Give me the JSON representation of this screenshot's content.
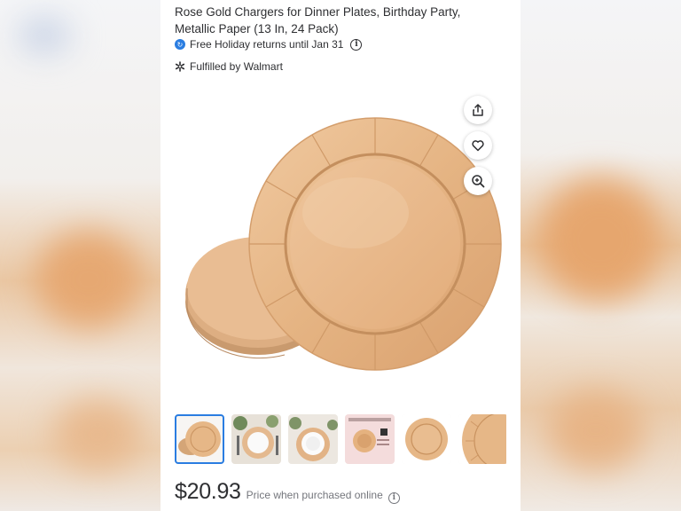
{
  "product": {
    "title": "Rose Gold Chargers for Dinner Plates, Birthday Party, Metallic Paper (13 In, 24 Pack)",
    "returns_text": "Free Holiday returns until Jan 31",
    "fulfilled_text": "Fulfilled by Walmart",
    "price": "$20.93",
    "price_note": "Price when purchased online"
  },
  "icons": {
    "returns": "returns-icon",
    "info": "info-icon",
    "spark": "walmart-spark-icon",
    "share": "share-icon",
    "favorite": "heart-icon",
    "zoom": "zoom-in-icon"
  },
  "gallery": {
    "selected_index": 0,
    "thumbnails": [
      "plate-stack",
      "table-setting",
      "white-plate-setting",
      "package-front",
      "single-plate",
      "plate-close-up"
    ]
  },
  "colors": {
    "accent": "#2a7de1",
    "plate": "#e6b787",
    "text": "#2e2f32",
    "muted": "#74767c"
  }
}
